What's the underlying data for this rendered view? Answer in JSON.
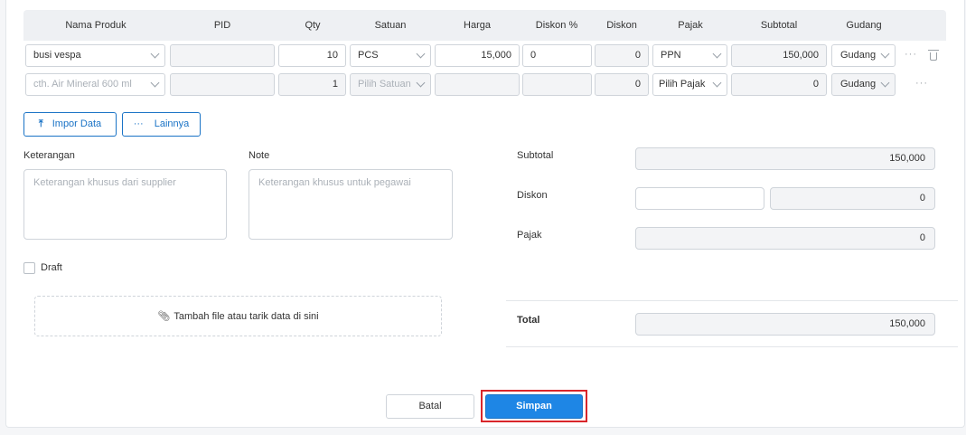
{
  "table": {
    "headers": [
      "Nama Produk",
      "PID",
      "Qty",
      "Satuan",
      "Harga",
      "Diskon %",
      "Diskon",
      "Pajak",
      "Subtotal",
      "Gudang"
    ],
    "row1": {
      "product": "busi vespa",
      "pid": "",
      "qty": "10",
      "unit": "PCS",
      "price": "15,000",
      "discount_pct": "0",
      "discount": "0",
      "tax": "PPN",
      "subtotal": "150,000",
      "warehouse": "Gudang"
    },
    "row2": {
      "product_placeholder": "cth. Air Mineral 600 ml",
      "qty": "1",
      "unit_placeholder": "Pilih Satuan",
      "discount": "0",
      "tax_placeholder": "Pilih Pajak",
      "subtotal": "0",
      "warehouse": "Gudang"
    },
    "more_glyph": "···"
  },
  "actions": {
    "import_label": "Impor Data",
    "more_label": "Lainnya"
  },
  "notes": {
    "keterangan_label": "Keterangan",
    "keterangan_placeholder": "Keterangan khusus dari supplier",
    "note_label": "Note",
    "note_placeholder": "Keterangan khusus untuk pegawai"
  },
  "draft_label": "Draft",
  "attach_label": "Tambah file atau tarik data di sini",
  "summary": {
    "subtotal_label": "Subtotal",
    "subtotal_value": "150,000",
    "discount_label": "Diskon",
    "discount_input": "",
    "discount_value": "0",
    "tax_label": "Pajak",
    "tax_value": "0",
    "total_label": "Total",
    "total_value": "150,000"
  },
  "footer": {
    "cancel_label": "Batal",
    "save_label": "Simpan"
  },
  "colors": {
    "primary": "#1e86e5",
    "highlight": "#d9262b",
    "header_bg": "#eef0f3"
  }
}
